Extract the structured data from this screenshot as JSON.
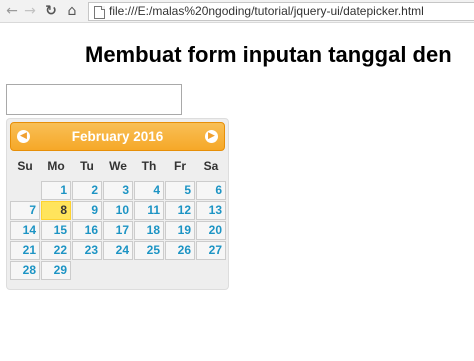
{
  "browser": {
    "url": "file:///E:/malas%20ngoding/tutorial/jquery-ui/datepicker.html",
    "icons": {
      "back": "back-arrow-icon",
      "forward": "forward-arrow-icon",
      "reload": "reload-icon",
      "home": "home-icon",
      "page": "page-icon"
    }
  },
  "page": {
    "title": "Membuat form inputan tanggal den",
    "date_input_value": ""
  },
  "datepicker": {
    "month_title": "February 2016",
    "weekdays": [
      "Su",
      "Mo",
      "Tu",
      "We",
      "Th",
      "Fr",
      "Sa"
    ],
    "days": [
      "",
      "1",
      "2",
      "3",
      "4",
      "5",
      "6",
      "7",
      "8",
      "9",
      "10",
      "11",
      "12",
      "13",
      "14",
      "15",
      "16",
      "17",
      "18",
      "19",
      "20",
      "21",
      "22",
      "23",
      "24",
      "25",
      "26",
      "27",
      "28",
      "29"
    ],
    "today": "8",
    "colors": {
      "header": "#f6a828",
      "day_text": "#1c94c4",
      "today_bg": "#ffe45c"
    }
  }
}
